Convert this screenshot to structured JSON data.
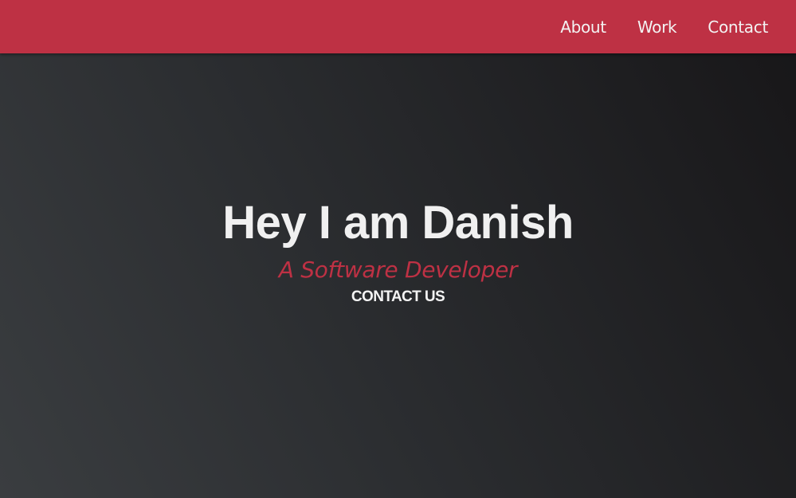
{
  "nav": {
    "links": [
      "About",
      "Work",
      "Contact"
    ]
  },
  "hero": {
    "title": "Hey I am Danish",
    "subtitle": "A Software Developer",
    "cta_label": "CONTACT US"
  },
  "colors": {
    "accent": "#be3144",
    "hero_gradient_light": "#3a3d40",
    "hero_gradient_dark": "#181719",
    "text_light": "#f0f0f0"
  }
}
